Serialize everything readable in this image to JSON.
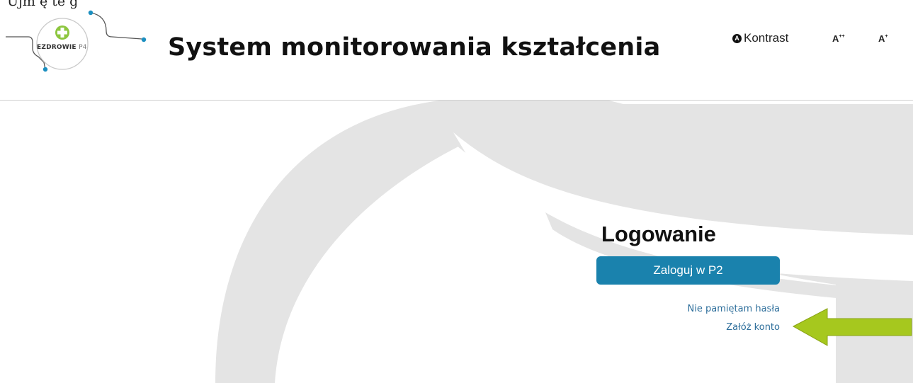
{
  "top_crop_text": "Ujm ę te g",
  "logo": {
    "text_main": "EZDROWIE",
    "text_suffix": "P4"
  },
  "header": {
    "title": "System monitorowania kształcenia",
    "kontrast_icon": "A",
    "kontrast_label": "Kontrast",
    "font_larger": {
      "base": "A",
      "sup": "++"
    },
    "font_large": {
      "base": "A",
      "sup": "+"
    }
  },
  "login": {
    "title": "Logowanie",
    "button_label": "Zaloguj w P2",
    "forgot_link": "Nie pamiętam hasła",
    "register_link": "Załóż konto"
  },
  "colors": {
    "button": "#1a82ad",
    "link": "#2d6e9b",
    "arrow": "#a6c81e",
    "background_shape": "#e4e4e4",
    "logo_green": "#8dc63f",
    "logo_dot": "#1b8fc0"
  },
  "icons": {
    "logo_cross": "plus-icon",
    "kontrast": "contrast-icon",
    "annotation": "left-arrow-icon"
  }
}
